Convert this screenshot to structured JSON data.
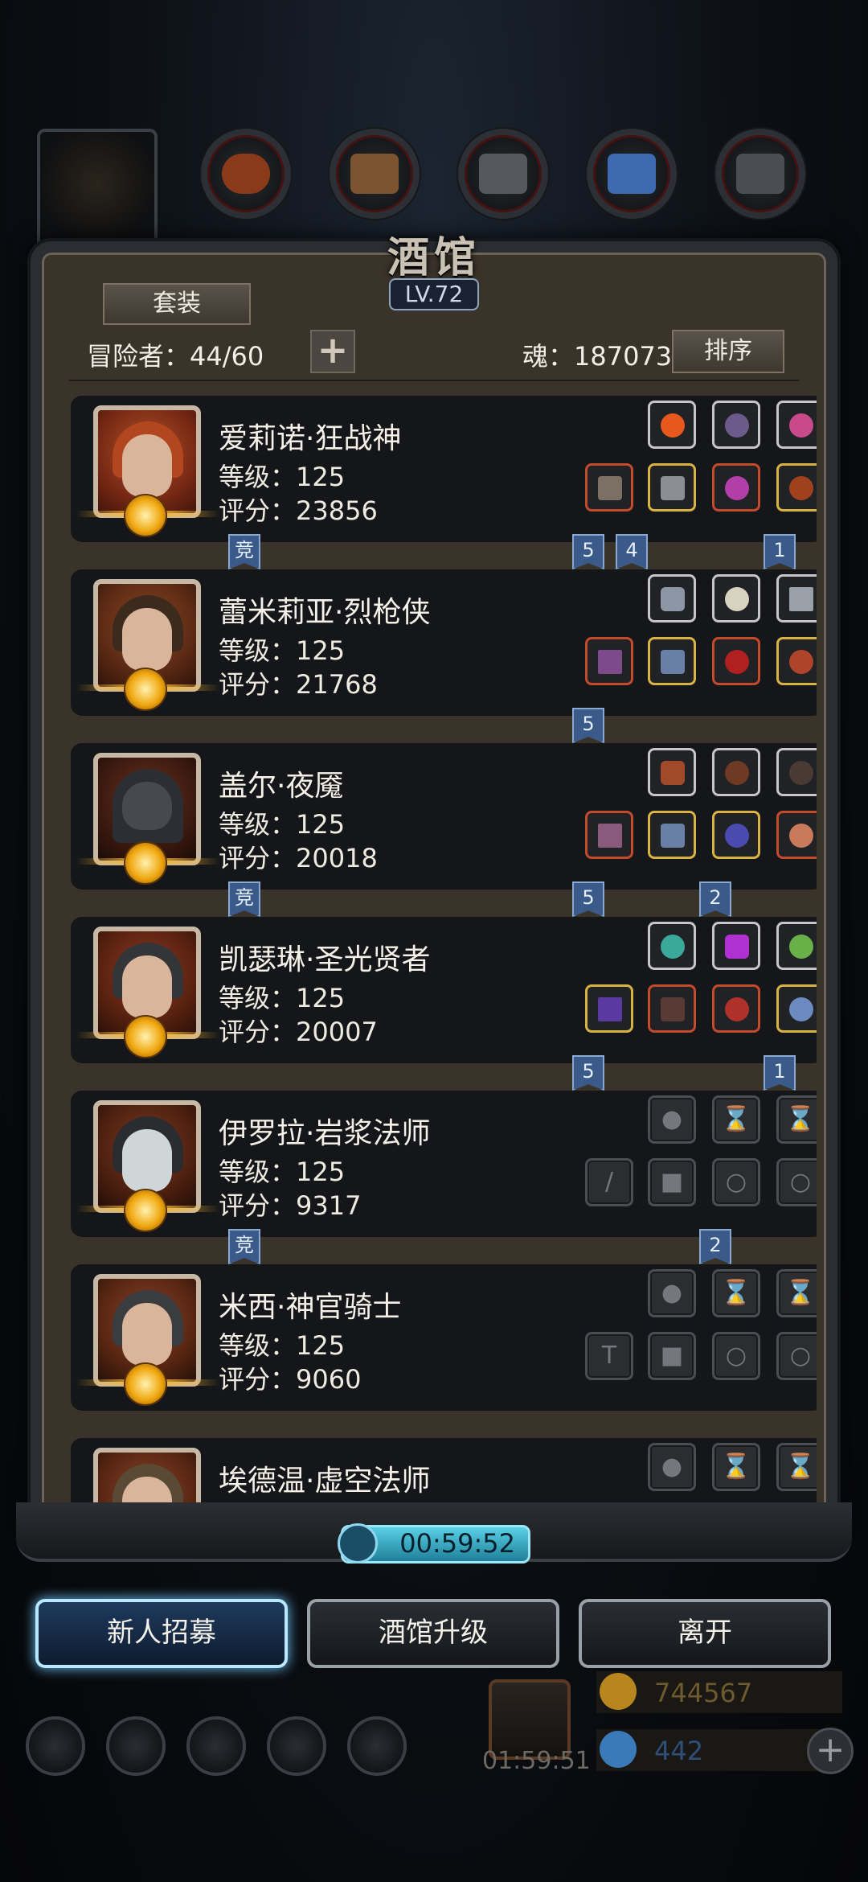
{
  "header": {
    "title": "酒馆",
    "level": "LV.72",
    "set_label": "套装",
    "adventurers": "冒险者：44/60",
    "soul": "魂：187073",
    "sort_label": "排序"
  },
  "heroes": [
    {
      "name": "爱莉诺·狂战神",
      "level": "等级：125",
      "score": "评分：23856",
      "portrait_color": "#b0532d",
      "hair_color": "#b2471f"
    },
    {
      "name": "蕾米莉亚·烈枪侠",
      "level": "等级：125",
      "score": "评分：21768",
      "portrait_color": "#8a4a24",
      "hair_color": "#3b2a1d"
    },
    {
      "name": "盖尔·夜魇",
      "level": "等级：125",
      "score": "评分：20018",
      "portrait_color": "#6b3220",
      "hair_color": "#2b2e33"
    },
    {
      "name": "凯瑟琳·圣光贤者",
      "level": "等级：125",
      "score": "评分：20007",
      "portrait_color": "#8c3b20",
      "hair_color": "#333538"
    },
    {
      "name": "伊罗拉·岩浆法师",
      "level": "等级：125",
      "score": "评分：9317",
      "portrait_color": "#7d3a22",
      "hair_color": "#2a2c30"
    },
    {
      "name": "米西·神官骑士",
      "level": "等级：125",
      "score": "评分：9060",
      "portrait_color": "#8a4527",
      "hair_color": "#3a3c40"
    },
    {
      "name": "埃德温·虚空法师",
      "level": "",
      "score": "",
      "portrait_color": "#8a4527",
      "hair_color": "#5a4a35"
    }
  ],
  "flags": {
    "competitive": "竞",
    "five": "5",
    "four": "4",
    "one": "1",
    "two": "2"
  },
  "timer": "00:59:52",
  "actions": {
    "recruit": "新人招募",
    "upgrade": "酒馆升级",
    "leave": "离开"
  },
  "gift_timer": "01:59:51",
  "resources": {
    "gold": "744567",
    "gems": "442"
  }
}
